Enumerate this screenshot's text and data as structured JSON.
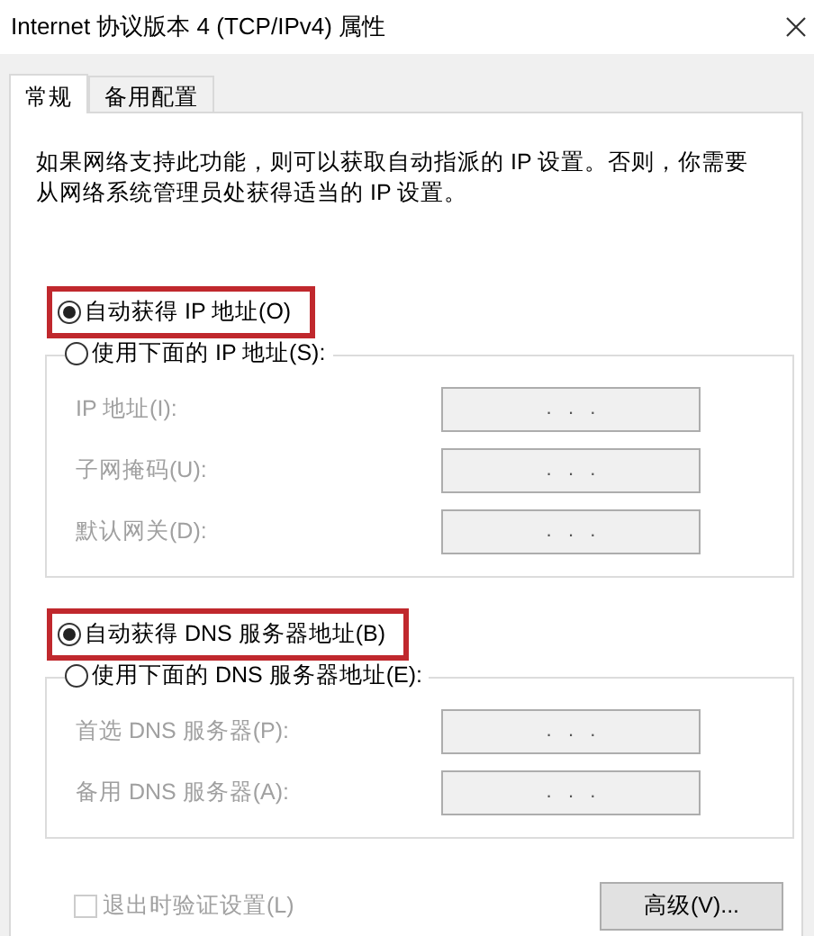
{
  "window": {
    "title": "Internet 协议版本 4 (TCP/IPv4) 属性"
  },
  "tabs": [
    {
      "label": "常规",
      "selected": true
    },
    {
      "label": "备用配置",
      "selected": false
    }
  ],
  "description": "如果网络支持此功能，则可以获取自动指派的 IP 设置。否则，你需要从网络系统管理员处获得适当的 IP 设置。",
  "sections": [
    {
      "auto_option": {
        "label": "自动获得 IP 地址(O)",
        "selected": true,
        "highlighted": true
      },
      "manual_option": {
        "label": "使用下面的 IP 地址(S):",
        "selected": false
      },
      "fields": [
        {
          "label": "IP 地址(I):",
          "value": ".   .   .",
          "disabled": true
        },
        {
          "label": "子网掩码(U):",
          "value": ".   .   .",
          "disabled": true
        },
        {
          "label": "默认网关(D):",
          "value": ".   .   .",
          "disabled": true
        }
      ]
    },
    {
      "auto_option": {
        "label": "自动获得 DNS 服务器地址(B)",
        "selected": true,
        "highlighted": true
      },
      "manual_option": {
        "label": "使用下面的 DNS 服务器地址(E):",
        "selected": false
      },
      "fields": [
        {
          "label": "首选 DNS 服务器(P):",
          "value": ".   .   .",
          "disabled": true
        },
        {
          "label": "备用 DNS 服务器(A):",
          "value": ".   .   .",
          "disabled": true
        }
      ]
    }
  ],
  "validate_checkbox": {
    "label": "退出时验证设置(L)",
    "checked": false,
    "disabled": true
  },
  "advanced_button": {
    "label": "高级(V)..."
  }
}
